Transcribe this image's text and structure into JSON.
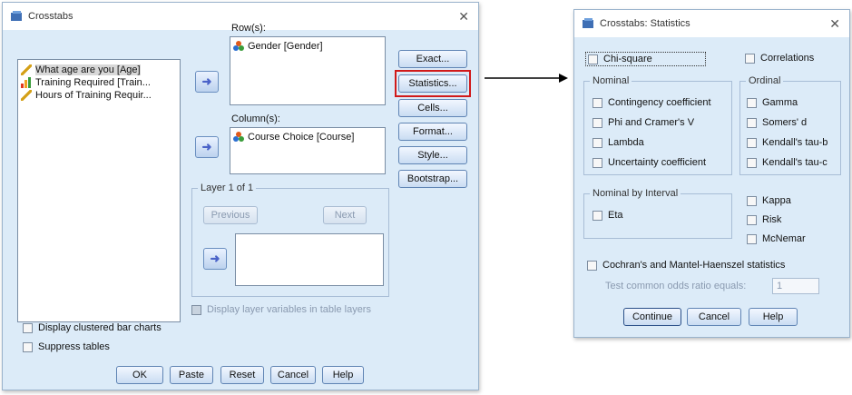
{
  "crosstabs": {
    "title": "Crosstabs",
    "variables": [
      {
        "label": "What age are you [Age]",
        "icon": "ruler-icon",
        "selected": true
      },
      {
        "label": "Training Required [Train...",
        "icon": "bar-chart-icon",
        "selected": false
      },
      {
        "label": "Hours of Training Requir...",
        "icon": "ruler-icon",
        "selected": false
      }
    ],
    "rows_label": "Row(s):",
    "rows": [
      {
        "label": "Gender [Gender]",
        "icon": "nominal-icon"
      }
    ],
    "columns_label": "Column(s):",
    "columns": [
      {
        "label": "Course Choice [Course]",
        "icon": "nominal-icon"
      }
    ],
    "layer_label": "Layer 1 of 1",
    "previous_label": "Previous",
    "next_label": "Next",
    "side_buttons": [
      "Exact...",
      "Statistics...",
      "Cells...",
      "Format...",
      "Style...",
      "Bootstrap..."
    ],
    "display_layer_label": "Display layer variables in table layers",
    "clustered_label": "Display clustered bar charts",
    "suppress_label": "Suppress tables",
    "bottom_buttons": [
      "OK",
      "Paste",
      "Reset",
      "Cancel",
      "Help"
    ]
  },
  "statistics": {
    "title": "Crosstabs: Statistics",
    "chi_square": "Chi-square",
    "correlations": "Correlations",
    "nominal_title": "Nominal",
    "nominal": [
      "Contingency coefficient",
      "Phi and Cramer's V",
      "Lambda",
      "Uncertainty coefficient"
    ],
    "ordinal_title": "Ordinal",
    "ordinal": [
      "Gamma",
      "Somers' d",
      "Kendall's tau-b",
      "Kendall's tau-c"
    ],
    "interval_title": "Nominal by Interval",
    "eta": "Eta",
    "kappa": "Kappa",
    "risk": "Risk",
    "mcnemar": "McNemar",
    "cochran": "Cochran's and Mantel-Haenszel statistics",
    "odds_label": "Test common odds ratio equals:",
    "odds_value": "1",
    "buttons": [
      "Continue",
      "Cancel",
      "Help"
    ]
  },
  "colors": {
    "highlight": "#d11a1a",
    "dialog_bg": "#dcebf8"
  }
}
